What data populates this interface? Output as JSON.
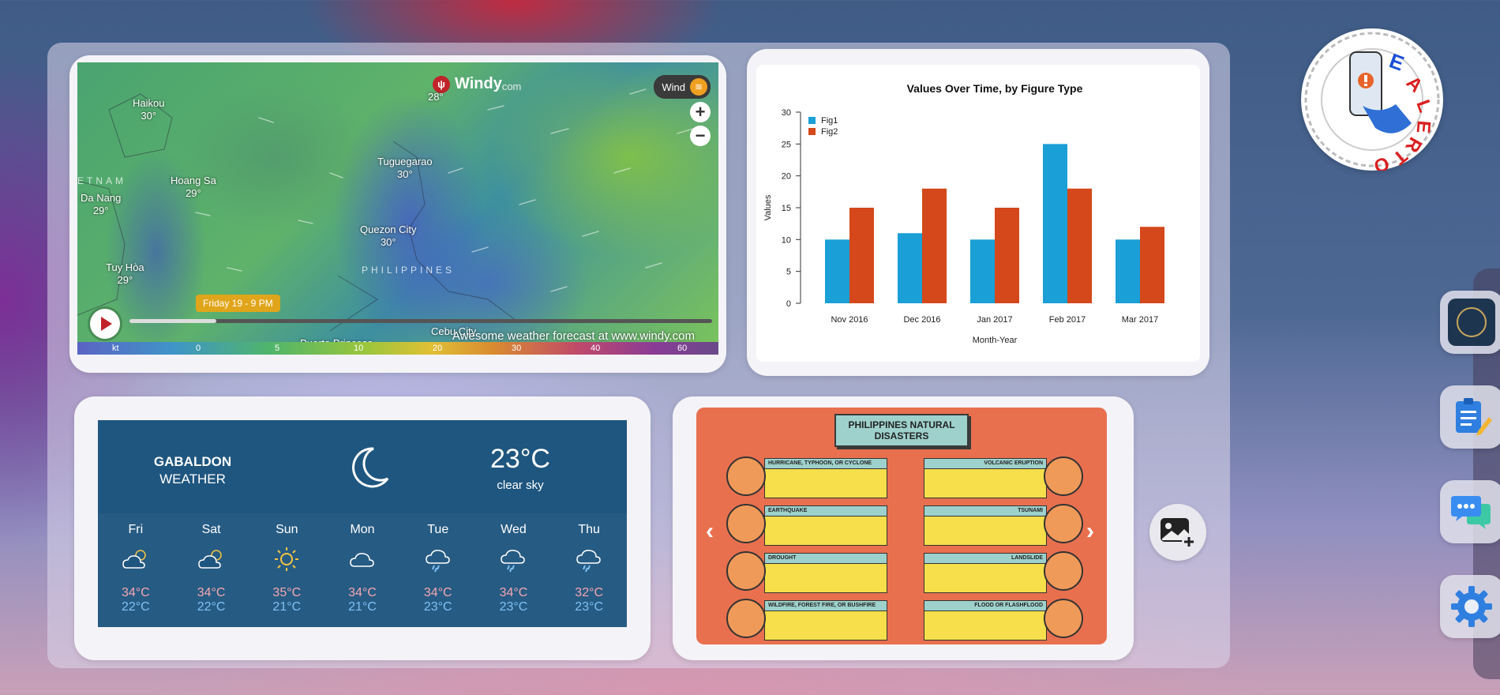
{
  "map": {
    "brand": "Windy",
    "brand_suffix": "com",
    "layer_label": "Wind",
    "time_label": "Friday 19 - 9 PM",
    "watermark": "Awesome weather forecast at www.windy.com",
    "zoom_in": "+",
    "zoom_out": "−",
    "region_label": "PHILIPPINES",
    "region_label_2": "ETNAM",
    "top_value": "28°",
    "cities": [
      {
        "name": "Haikou",
        "temp": "30°"
      },
      {
        "name": "Hoang Sa",
        "temp": "29°"
      },
      {
        "name": "Da Nang",
        "temp": "29°"
      },
      {
        "name": "Tuy Hòa",
        "temp": "29°"
      },
      {
        "name": "Tuguegarao",
        "temp": "30°"
      },
      {
        "name": "Quezon City",
        "temp": "30°"
      },
      {
        "name": "Cebu City",
        "temp": ""
      },
      {
        "name": "Puerto Princesa",
        "temp": ""
      }
    ],
    "scale": [
      "kt",
      "0",
      "5",
      "10",
      "20",
      "30",
      "40",
      "60"
    ]
  },
  "chart_data": {
    "type": "bar",
    "title": "Values Over Time, by Figure Type",
    "xlabel": "Month-Year",
    "ylabel": "Values",
    "ylim": [
      0,
      30
    ],
    "yticks": [
      0,
      5,
      10,
      15,
      20,
      25,
      30
    ],
    "categories": [
      "Nov 2016",
      "Dec 2016",
      "Jan 2017",
      "Feb 2017",
      "Mar 2017"
    ],
    "series": [
      {
        "name": "Fig1",
        "color": "#1a9fd6",
        "values": [
          10,
          11,
          10,
          25,
          10
        ]
      },
      {
        "name": "Fig2",
        "color": "#d4481b",
        "values": [
          15,
          18,
          15,
          18,
          12
        ]
      }
    ],
    "legend": "top-left",
    "grid": false
  },
  "weather": {
    "location": "GABALDON",
    "subtitle": "WEATHER",
    "current_temp": "23°C",
    "condition": "clear sky",
    "current_icon": "moon-icon",
    "days": [
      {
        "day": "Fri",
        "icon": "partly-cloudy-icon",
        "hi": "34°C",
        "lo": "22°C"
      },
      {
        "day": "Sat",
        "icon": "partly-cloudy-icon",
        "hi": "34°C",
        "lo": "22°C"
      },
      {
        "day": "Sun",
        "icon": "sun-icon",
        "hi": "35°C",
        "lo": "21°C"
      },
      {
        "day": "Mon",
        "icon": "cloud-icon",
        "hi": "34°C",
        "lo": "21°C"
      },
      {
        "day": "Tue",
        "icon": "rain-icon",
        "hi": "34°C",
        "lo": "23°C"
      },
      {
        "day": "Wed",
        "icon": "rain-icon",
        "hi": "34°C",
        "lo": "23°C"
      },
      {
        "day": "Thu",
        "icon": "rain-icon",
        "hi": "32°C",
        "lo": "23°C"
      }
    ]
  },
  "disasters": {
    "title": "PHILIPPINES NATURAL DISASTERS",
    "prev": "‹",
    "next": "›",
    "tiles": [
      {
        "label": "HURRICANE, TYPHOON, OR CYCLONE",
        "side": "left"
      },
      {
        "label": "EARTHQUAKE",
        "side": "left"
      },
      {
        "label": "DROUGHT",
        "side": "left"
      },
      {
        "label": "WILDFIRE, FOREST FIRE, OR BUSHFIRE",
        "side": "left"
      },
      {
        "label": "VOLCANIC ERUPTION",
        "side": "right"
      },
      {
        "label": "TSUNAMI",
        "side": "right"
      },
      {
        "label": "LANDSLIDE",
        "side": "right"
      },
      {
        "label": "FLOOD OR FLASHFLOOD",
        "side": "right"
      }
    ]
  },
  "logo": {
    "text": "E-ALERTO"
  },
  "dock": {
    "items": [
      "app-logo-icon",
      "clipboard-edit-icon",
      "chat-icon",
      "settings-icon"
    ]
  },
  "actions": {
    "add_photo_icon": "add-photo-icon"
  }
}
